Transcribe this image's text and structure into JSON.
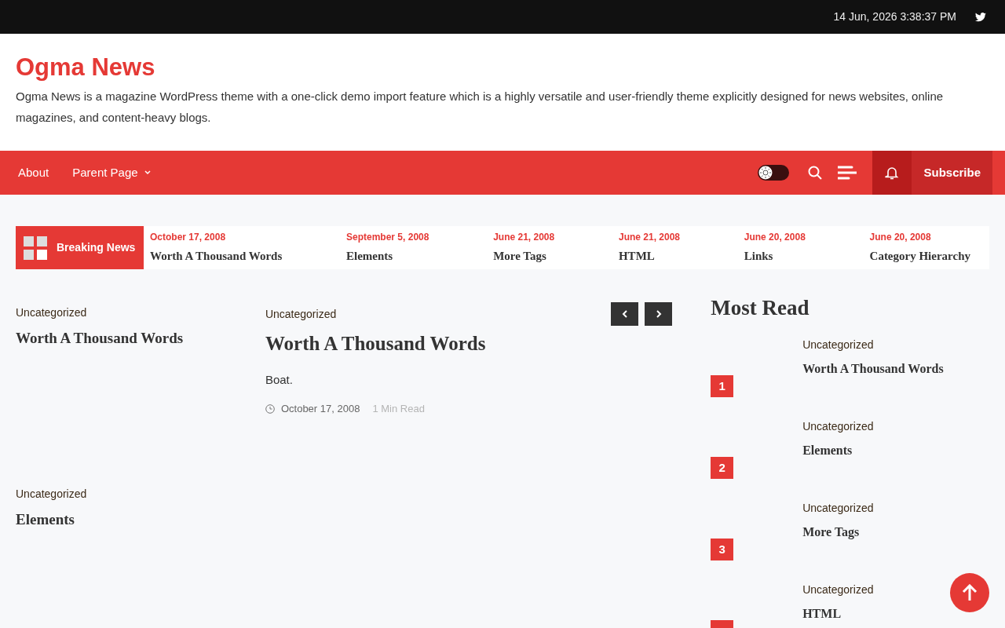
{
  "top_bar": {
    "datetime": "14 Jun, 2026 3:38:37 PM"
  },
  "site": {
    "title": "Ogma News",
    "description": "Ogma News is a magazine WordPress theme with a one-click demo import feature which is a highly versatile and user-friendly theme explicitly designed for news websites, online magazines, and content-heavy blogs."
  },
  "nav": {
    "items": [
      {
        "label": "About",
        "has_dropdown": false
      },
      {
        "label": "Parent Page",
        "has_dropdown": true
      }
    ],
    "dark_mode": false,
    "subscribe": "Subscribe"
  },
  "breaking_news": {
    "label": "Breaking News",
    "items": [
      {
        "date": "October 17, 2008",
        "title": "Worth A Thousand Words"
      },
      {
        "date": "September 5, 2008",
        "title": "Elements"
      },
      {
        "date": "June 21, 2008",
        "title": "More Tags"
      },
      {
        "date": "June 21, 2008",
        "title": "HTML"
      },
      {
        "date": "June 20, 2008",
        "title": "Links"
      },
      {
        "date": "June 20, 2008",
        "title": "Category Hierarchy"
      }
    ]
  },
  "left_posts": [
    {
      "category": "Uncategorized",
      "title": "Worth A Thousand Words"
    },
    {
      "category": "Uncategorized",
      "title": "Elements"
    }
  ],
  "featured": {
    "category": "Uncategorized",
    "title": "Worth A Thousand Words",
    "excerpt": "Boat.",
    "date": "October 17, 2008",
    "read_time": "1 Min Read"
  },
  "most_read": {
    "title": "Most Read",
    "items": [
      {
        "rank": "1",
        "category": "Uncategorized",
        "title": "Worth A Thousand Words"
      },
      {
        "rank": "2",
        "category": "Uncategorized",
        "title": "Elements"
      },
      {
        "rank": "3",
        "category": "Uncategorized",
        "title": "More Tags"
      },
      {
        "category": "Uncategorized",
        "title": "HTML"
      }
    ]
  }
}
